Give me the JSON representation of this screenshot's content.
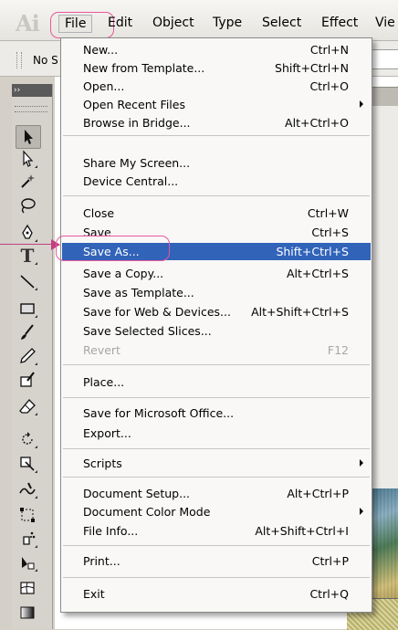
{
  "app": {
    "logo": "Ai"
  },
  "menubar": {
    "items": [
      "File",
      "Edit",
      "Object",
      "Type",
      "Select",
      "Effect",
      "Vie"
    ]
  },
  "controlbar": {
    "selection_text": "No S"
  },
  "tools_panel": {
    "collapse_glyph": "››"
  },
  "file_menu": {
    "groups": [
      [
        {
          "label": "New...",
          "shortcut": "Ctrl+N"
        },
        {
          "label": "New from Template...",
          "shortcut": "Shift+Ctrl+N"
        },
        {
          "label": "Open...",
          "shortcut": "Ctrl+O"
        },
        {
          "label": "Open Recent Files",
          "shortcut": "",
          "submenu": true
        },
        {
          "label": "Browse in Bridge...",
          "shortcut": "Alt+Ctrl+O"
        }
      ],
      [
        {
          "label": "Share My Screen...",
          "shortcut": ""
        },
        {
          "label": "Device Central...",
          "shortcut": ""
        }
      ],
      [
        {
          "label": "Close",
          "shortcut": "Ctrl+W"
        },
        {
          "label": "Save",
          "shortcut": "Ctrl+S"
        },
        {
          "label": "Save As...",
          "shortcut": "Shift+Ctrl+S",
          "highlighted": true
        },
        {
          "label": "Save a Copy...",
          "shortcut": "Alt+Ctrl+S"
        },
        {
          "label": "Save as Template...",
          "shortcut": ""
        },
        {
          "label": "Save for Web & Devices...",
          "shortcut": "Alt+Shift+Ctrl+S"
        },
        {
          "label": "Save Selected Slices...",
          "shortcut": ""
        },
        {
          "label": "Revert",
          "shortcut": "F12",
          "disabled": true
        }
      ],
      [
        {
          "label": "Place...",
          "shortcut": ""
        }
      ],
      [
        {
          "label": "Save for Microsoft Office...",
          "shortcut": ""
        },
        {
          "label": "Export...",
          "shortcut": ""
        }
      ],
      [
        {
          "label": "Scripts",
          "shortcut": "",
          "submenu": true
        }
      ],
      [
        {
          "label": "Document Setup...",
          "shortcut": "Alt+Ctrl+P"
        },
        {
          "label": "Document Color Mode",
          "shortcut": "",
          "submenu": true
        },
        {
          "label": "File Info...",
          "shortcut": "Alt+Shift+Ctrl+I"
        }
      ],
      [
        {
          "label": "Print...",
          "shortcut": "Ctrl+P"
        }
      ],
      [
        {
          "label": "Exit",
          "shortcut": "Ctrl+Q"
        }
      ]
    ]
  },
  "colors": {
    "highlight": "#3163b9",
    "annotation": "#e8579c",
    "menu_bg": "#f9f8f7",
    "disabled_text": "#a6a6a6"
  },
  "tools": [
    "selection-tool-icon",
    "direct-selection-tool-icon",
    "magic-wand-tool-icon",
    "lasso-tool-icon",
    "pen-tool-icon",
    "type-tool-icon",
    "line-segment-tool-icon",
    "rectangle-tool-icon",
    "paintbrush-tool-icon",
    "pencil-tool-icon",
    "blob-brush-tool-icon",
    "eraser-tool-icon",
    "rotate-tool-icon",
    "scale-tool-icon",
    "warp-tool-icon",
    "free-transform-tool-icon",
    "symbol-sprayer-tool-icon",
    "column-graph-tool-icon",
    "mesh-tool-icon",
    "gradient-tool-icon"
  ]
}
